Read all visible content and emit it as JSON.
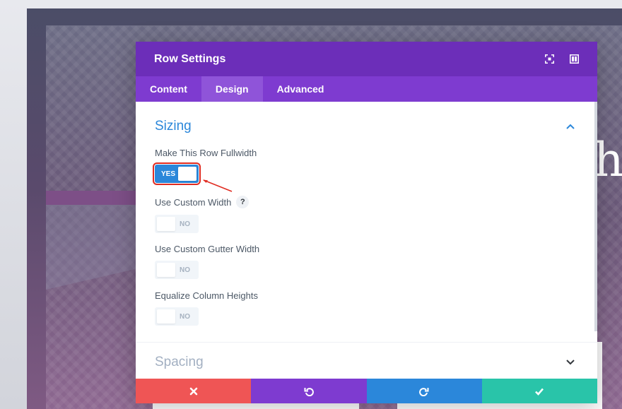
{
  "background": {
    "heading_fragment": "hi"
  },
  "modal": {
    "title": "Row Settings",
    "header_icons": [
      "expand-icon",
      "sidebar-layout-icon"
    ],
    "tabs": [
      {
        "label": "Content",
        "active": false
      },
      {
        "label": "Design",
        "active": true
      },
      {
        "label": "Advanced",
        "active": false
      }
    ],
    "sections": {
      "sizing": {
        "title": "Sizing",
        "fields": {
          "fullwidth": {
            "label": "Make This Row Fullwidth",
            "value": "YES"
          },
          "custom_width": {
            "label": "Use Custom Width",
            "help": "?",
            "value": "NO"
          },
          "gutter": {
            "label": "Use Custom Gutter Width",
            "value": "NO"
          },
          "equalize": {
            "label": "Equalize Column Heights",
            "value": "NO"
          }
        }
      },
      "spacing": {
        "title": "Spacing"
      }
    },
    "footer_icons": [
      "close-icon",
      "undo-icon",
      "redo-icon",
      "check-icon"
    ]
  },
  "colors": {
    "header": "#6c2eb9",
    "tabs": "#7e3bd0",
    "accent_blue": "#2b87da",
    "cancel": "#ef5555",
    "save": "#29c4a9",
    "highlight": "#e02b20"
  }
}
